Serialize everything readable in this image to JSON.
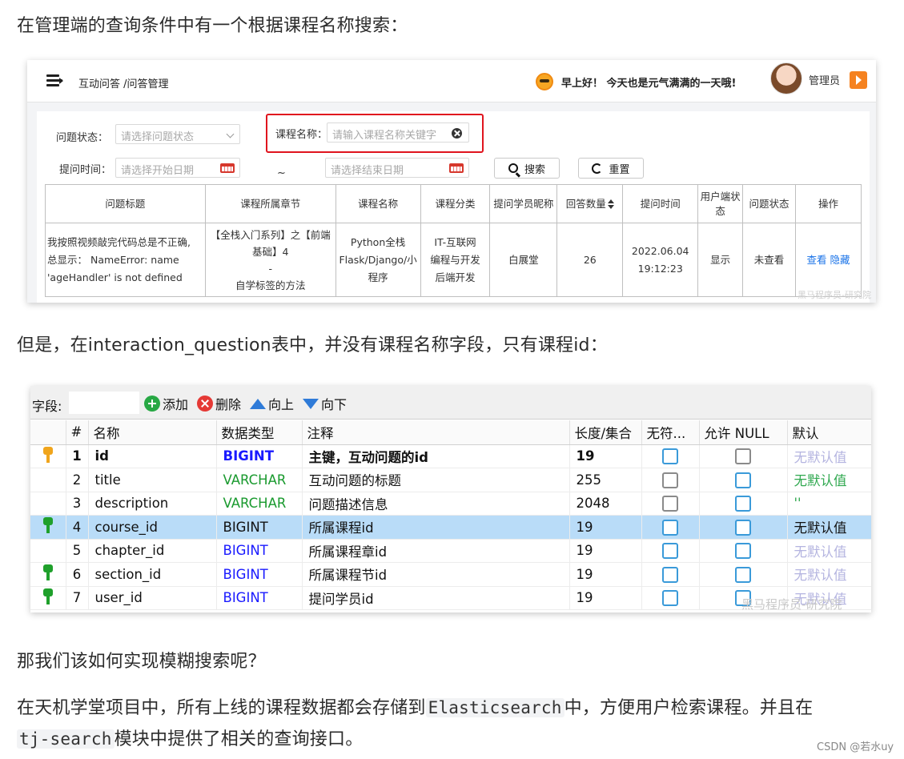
{
  "paragraphs": {
    "p1": "在管理端的查询条件中有一个根据课程名称搜索：",
    "p2": "但是，在interaction_question表中，并没有课程名称字段，只有课程id：",
    "p3": "那我们该如何实现模糊搜索呢？",
    "p4_a": "在天机学堂项目中，所有上线的课程数据都会存储到",
    "p4_code1": "Elasticsearch",
    "p4_b": "中，方便用户检索课程。并且在",
    "p5_code": "tj-search",
    "p5_b": "模块中提供了相关的查询接口。"
  },
  "screenshot1": {
    "breadcrumb": "互动问答 /问答管理",
    "greeting": "早上好！ 今天也是元气满满的一天哦!",
    "admin": "管理员",
    "filters": {
      "status_label": "问题状态：",
      "status_placeholder": "请选择问题状态",
      "course_label": "课程名称：",
      "course_placeholder": "请输入课程名称关键字",
      "time_label": "提问时间：",
      "start_placeholder": "请选择开始日期",
      "tilde": "~",
      "end_placeholder": "请选择结束日期",
      "search_btn": "搜索",
      "reset_btn": "重置"
    },
    "table": {
      "headers": [
        "问题标题",
        "课程所属章节",
        "课程名称",
        "课程分类",
        "提问学员昵称",
        "回答数量",
        "提问时间",
        "用户端状态",
        "问题状态",
        "操作"
      ],
      "row": {
        "title_1": "我按照视频敲完代码总是不正确,",
        "title_2": "总显示： NameError: name",
        "title_3": "'ageHandler' is not defined",
        "chapter_1": "【全栈入门系列】之【前端",
        "chapter_2": "基础】4",
        "chapter_3": "-",
        "chapter_4": "自学标签的方法",
        "course_1": "Python全栈",
        "course_2": "Flask/Django/小",
        "course_3": "程序",
        "cat_1": "IT-互联网",
        "cat_2": "编程与开发",
        "cat_3": "后端开发",
        "student": "白展堂",
        "answers": "26",
        "time_1": "2022.06.04",
        "time_2": "19:12:23",
        "user_status": "显示",
        "q_status": "未查看",
        "op_view": "查看",
        "op_hide": "隐藏"
      }
    },
    "watermark": "黑马程序员-研究院"
  },
  "screenshot2": {
    "toolbar": {
      "field_label": "字段:",
      "add": "添加",
      "delete": "删除",
      "up": "向上",
      "down": "向下"
    },
    "headers": [
      "#",
      "名称",
      "数据类型",
      "注释",
      "长度/集合",
      "无符...",
      "允许 NULL",
      "默认"
    ],
    "rows": [
      {
        "num": "1",
        "name": "id",
        "type": "BIGINT",
        "comment": "主键，互动问题的id",
        "len": "19",
        "default": "无默认值"
      },
      {
        "num": "2",
        "name": "title",
        "type": "VARCHAR",
        "comment": "互动问题的标题",
        "len": "255",
        "default": "无默认值"
      },
      {
        "num": "3",
        "name": "description",
        "type": "VARCHAR",
        "comment": "问题描述信息",
        "len": "2048",
        "default": "''"
      },
      {
        "num": "4",
        "name": "course_id",
        "type": "BIGINT",
        "comment": "所属课程id",
        "len": "19",
        "default": "无默认值"
      },
      {
        "num": "5",
        "name": "chapter_id",
        "type": "BIGINT",
        "comment": "所属课程章id",
        "len": "19",
        "default": "无默认值"
      },
      {
        "num": "6",
        "name": "section_id",
        "type": "BIGINT",
        "comment": "所属课程节id",
        "len": "19",
        "default": "无默认值"
      },
      {
        "num": "7",
        "name": "user_id",
        "type": "BIGINT",
        "comment": "提问学员id",
        "len": "19",
        "default": "无默认值"
      }
    ],
    "watermark": "黑马程序员-研究院"
  },
  "footer": {
    "csdn": "CSDN @若水uy"
  }
}
